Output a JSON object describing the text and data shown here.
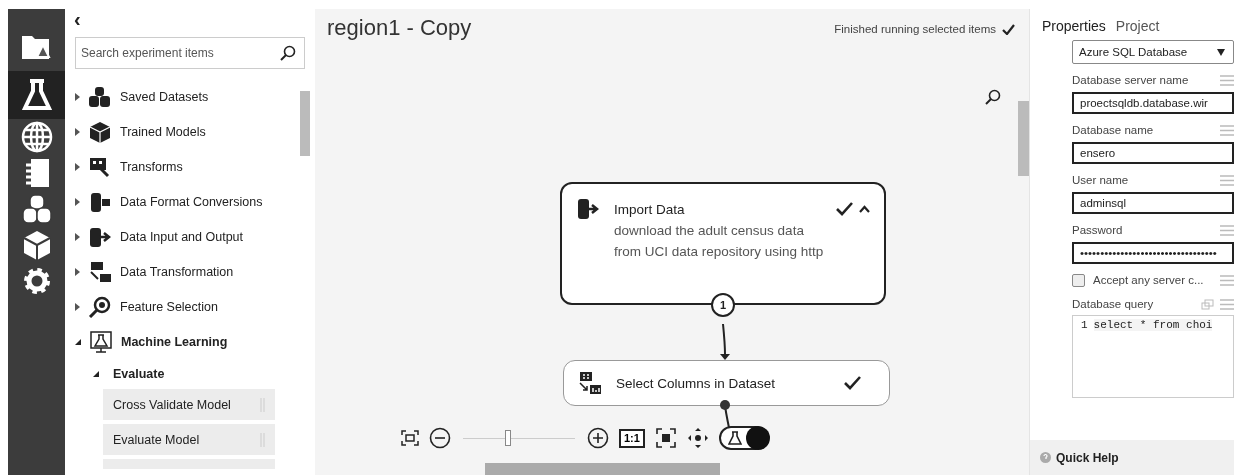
{
  "nav": [
    {
      "selected": false
    },
    {
      "selected": true
    },
    {
      "selected": false
    },
    {
      "selected": false
    },
    {
      "selected": false
    },
    {
      "selected": false
    },
    {
      "selected": false
    }
  ],
  "palette": {
    "collapse": "‹",
    "search": {
      "placeholder": "Search experiment items"
    },
    "items": [
      {
        "label": "Saved Datasets",
        "expanded": false
      },
      {
        "label": "Trained Models",
        "expanded": false
      },
      {
        "label": "Transforms",
        "expanded": false
      },
      {
        "label": "Data Format Conversions",
        "expanded": false
      },
      {
        "label": "Data Input and Output",
        "expanded": false
      },
      {
        "label": "Data Transformation",
        "expanded": false
      },
      {
        "label": "Feature Selection",
        "expanded": false
      },
      {
        "label": "Machine Learning",
        "expanded": true,
        "children": [
          {
            "label": "Evaluate",
            "expanded": true,
            "children": [
              {
                "label": "Cross Validate Model"
              },
              {
                "label": "Evaluate Model"
              }
            ]
          }
        ]
      }
    ]
  },
  "canvas": {
    "title": "region1 - Copy",
    "status": "Finished running selected items",
    "status_done": true,
    "nodes": [
      {
        "title": "Import Data",
        "description": "download the adult census data from UCI data repository using http",
        "completed": true,
        "expanded": true,
        "output_port": "1"
      },
      {
        "title": "Select Columns in Dataset",
        "completed": true,
        "expanded": false
      }
    ],
    "toolbar": {
      "zoom": {
        "level": 0.4
      },
      "actual_size": "1:1",
      "run_on": true
    }
  },
  "properties": {
    "tabs": [
      {
        "label": "Properties",
        "selected": true
      },
      {
        "label": "Project",
        "selected": false
      }
    ],
    "fields": [
      {
        "kind": "select",
        "value": "Azure SQL Database"
      },
      {
        "kind": "text",
        "label": "Database server name",
        "value": "proectsqldb.database.wir"
      },
      {
        "kind": "text",
        "label": "Database name",
        "value": "ensero"
      },
      {
        "kind": "text",
        "label": "User name",
        "value": "adminsql"
      },
      {
        "kind": "text",
        "label": "Password",
        "value": "••••••••••••••••••••••••••••••••••"
      },
      {
        "kind": "checkbox",
        "label": "Accept any server c...",
        "checked": false
      },
      {
        "kind": "code",
        "label": "Database query",
        "line": "1",
        "value": "select * from choi"
      }
    ],
    "quick_help": "Quick Help"
  }
}
